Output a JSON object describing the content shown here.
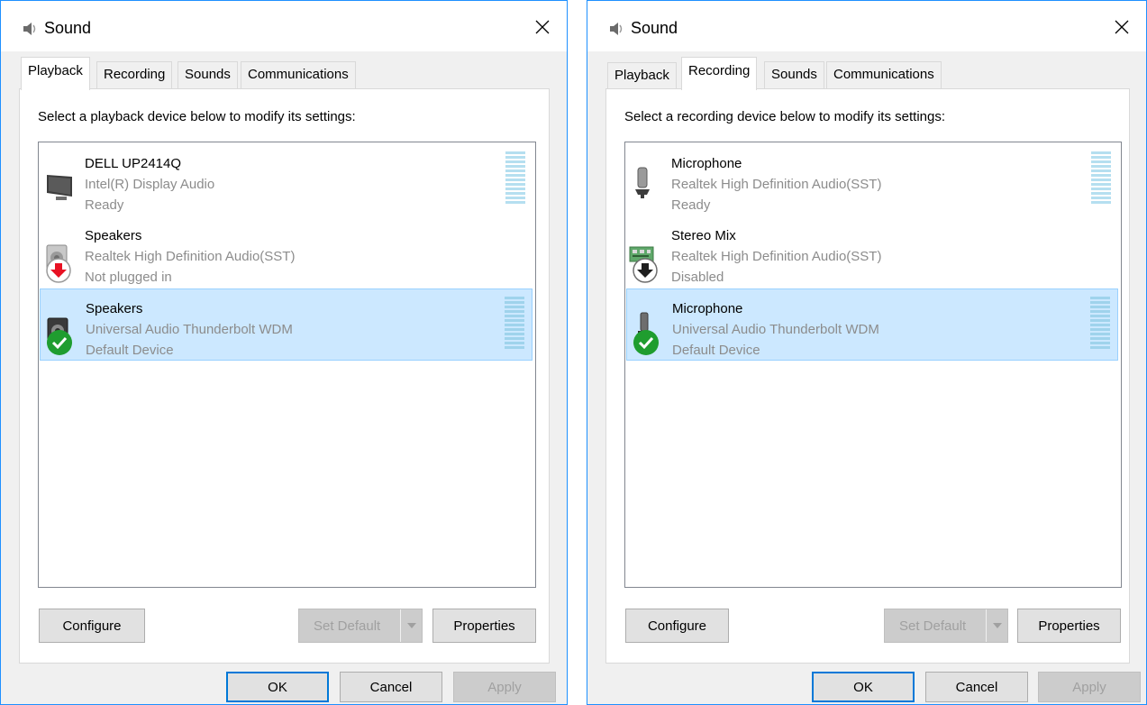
{
  "windows": [
    {
      "title": "Sound",
      "tabs": [
        {
          "label": "Playback",
          "active": true
        },
        {
          "label": "Recording",
          "active": false
        },
        {
          "label": "Sounds",
          "active": false
        },
        {
          "label": "Communications",
          "active": false
        }
      ],
      "instruction": "Select a playback device below to modify its settings:",
      "devices": [
        {
          "name": "DELL UP2414Q",
          "driver": "Intel(R) Display Audio",
          "status": "Ready",
          "icon": "monitor-icon",
          "selected": false
        },
        {
          "name": "Speakers",
          "driver": "Realtek High Definition Audio(SST)",
          "status": "Not plugged in",
          "icon": "speaker-icon",
          "badge": "red-down-arrow-badge",
          "selected": false
        },
        {
          "name": "Speakers",
          "driver": "Universal Audio Thunderbolt WDM",
          "status": "Default Device",
          "icon": "speaker-icon",
          "badge": "green-check-badge",
          "selected": true
        }
      ],
      "buttons": {
        "configure": "Configure",
        "set_default": "Set Default",
        "properties": "Properties",
        "ok": "OK",
        "cancel": "Cancel",
        "apply": "Apply"
      }
    },
    {
      "title": "Sound",
      "tabs": [
        {
          "label": "Playback",
          "active": false
        },
        {
          "label": "Recording",
          "active": true
        },
        {
          "label": "Sounds",
          "active": false
        },
        {
          "label": "Communications",
          "active": false
        }
      ],
      "instruction": "Select a recording device below to modify its settings:",
      "devices": [
        {
          "name": "Microphone",
          "driver": "Realtek High Definition Audio(SST)",
          "status": "Ready",
          "icon": "microphone-icon",
          "selected": false
        },
        {
          "name": "Stereo Mix",
          "driver": "Realtek High Definition Audio(SST)",
          "status": "Disabled",
          "icon": "circuit-board-icon",
          "badge": "black-down-arrow-badge",
          "selected": false
        },
        {
          "name": "Microphone",
          "driver": "Universal Audio Thunderbolt WDM",
          "status": "Default Device",
          "icon": "microphone-icon",
          "badge": "green-check-badge",
          "selected": true
        }
      ],
      "buttons": {
        "configure": "Configure",
        "set_default": "Set Default",
        "properties": "Properties",
        "ok": "OK",
        "cancel": "Cancel",
        "apply": "Apply"
      }
    }
  ],
  "colors": {
    "accent": "#0078d7",
    "selection": "#cce8ff",
    "meter": "#b5dff0",
    "meter_selected": "#9fd3ec",
    "check_green": "#1f9d2f",
    "arrow_red": "#e81123"
  }
}
